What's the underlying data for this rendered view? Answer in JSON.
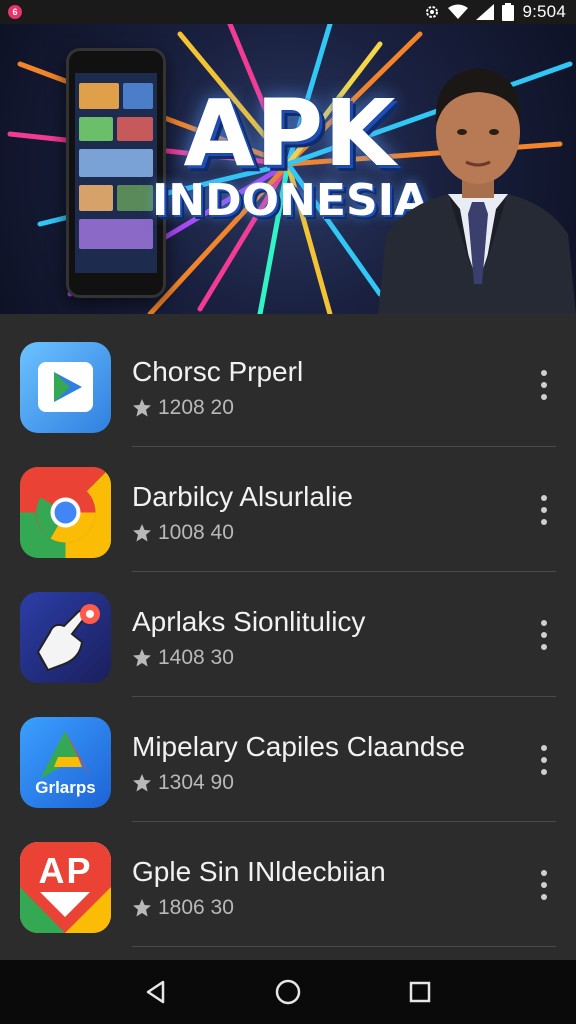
{
  "status_bar": {
    "time": "9:50",
    "extra": "4",
    "icons": [
      "notification-icon",
      "settings-icon",
      "wifi-icon",
      "signal-icon",
      "battery-icon"
    ]
  },
  "banner": {
    "title_line1": "APK",
    "title_line2": "INDONESIA"
  },
  "apps": [
    {
      "name": "Chorsc Prperl",
      "rating": "1208 20",
      "icon": "play-store-icon"
    },
    {
      "name": "Darbilcy Alsurlalie",
      "rating": "1008 40",
      "icon": "chrome-icon"
    },
    {
      "name": "Aprlaks Sionlitulicy",
      "rating": "1408 30",
      "icon": "thumbs-up-icon"
    },
    {
      "name": "Mipelary Capiles Claandse",
      "rating": "1304 90",
      "icon": "grlarps-icon",
      "icon_text": "Grlarps"
    },
    {
      "name": "Gple Sin INldecbiian",
      "rating": "1806 30",
      "icon": "ap-icon",
      "icon_text": "AP"
    }
  ],
  "nav": {
    "icons": [
      "back-icon",
      "home-icon",
      "recents-icon"
    ]
  }
}
